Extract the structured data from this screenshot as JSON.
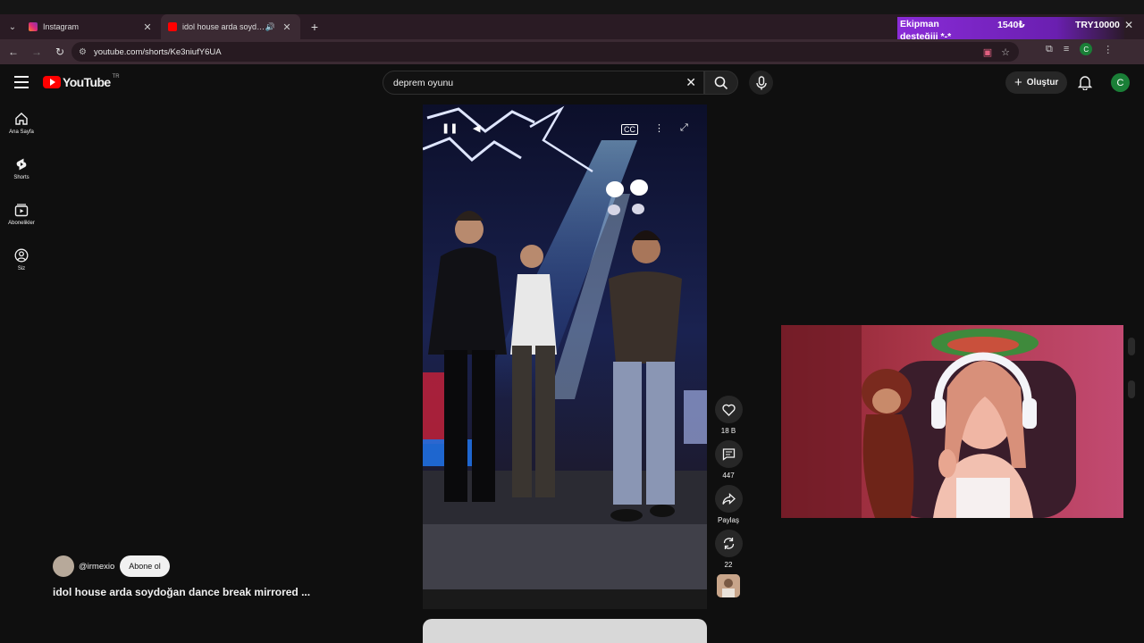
{
  "browser": {
    "tabs": [
      {
        "title": "Instagram",
        "favicon_color": "#e1306c",
        "active": false
      },
      {
        "title": "idol house arda soydoğan dance break mirrored",
        "favicon_color": "#ff0000",
        "active": true
      }
    ],
    "url": "youtube.com/shorts/Ke3niufY6UA",
    "profile_initial": "C"
  },
  "overlay": {
    "donor_line1": "Ekipman",
    "donor_line2": "desteğiii *-*",
    "amount_try": "1540₺",
    "amount_label": "TRY10000"
  },
  "youtube": {
    "logo_text": "YouTube",
    "country_code": "TR",
    "search_query": "deprem oyunu",
    "create_label": "Oluştur",
    "avatar_initial": "C",
    "sidebar": [
      {
        "label": "Ana Sayfa",
        "icon": "home-icon"
      },
      {
        "label": "Shorts",
        "icon": "shorts-icon"
      },
      {
        "label": "Abonelikler",
        "icon": "subscriptions-icon"
      },
      {
        "label": "Siz",
        "icon": "user-icon"
      }
    ],
    "actions": {
      "likes": "18 B",
      "comments": "447",
      "share": "Paylaş",
      "remix": "22"
    },
    "channel": {
      "handle": "@irmexio",
      "subscribe_label": "Abone ol"
    },
    "video_title": "idol house arda soydoğan dance break mirrored ..."
  },
  "colors": {
    "accent_red": "#ff0000",
    "donation_purple": "#8a2bd8",
    "tab_bar": "#2a1b24"
  }
}
